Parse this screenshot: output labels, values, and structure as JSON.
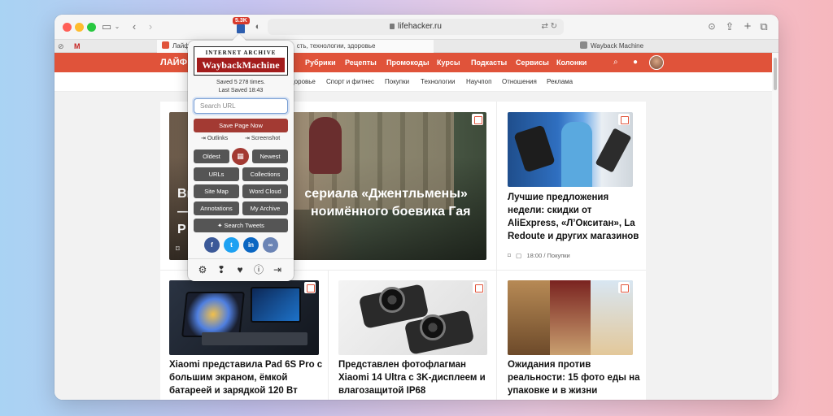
{
  "toolbar": {
    "url": "lifehacker.ru",
    "extension_badge": "5.3K"
  },
  "tabs": [
    {
      "label": "Лайфх",
      "rest": "сть, технологии, здоровье",
      "active": true
    },
    {
      "label": "Wayback Machine",
      "active": false
    }
  ],
  "site": {
    "logo": "ЛАЙФ",
    "nav": [
      "Рубрики",
      "Рецепты",
      "Промокоды",
      "Курсы",
      "Подкасты",
      "Сервисы",
      "Колонки"
    ],
    "subnav": [
      "доровье",
      "Спорт и фитнес",
      "Покупки",
      "Технологии",
      "Научпоп",
      "Отношения",
      "Реклама"
    ]
  },
  "articles": {
    "hero": {
      "title": "Вышел трейлер сериала «Джентльмены» — продолжения одноимённого боевика Гая Ричи",
      "visible_left": "Вь",
      "visible_right": "сериала «Джентльмены»",
      "line2_left": "—",
      "line2_right": "ноимённого боевика Гая",
      "line3_left": "Р"
    },
    "deals": {
      "title": "Лучшие предложения недели: скидки от AliExpress, «Л’Окситан», La Redoute и других магазинов",
      "time": "18:00",
      "category": "Покупки"
    },
    "xiaomi_pad": {
      "title": "Xiaomi представила Pad 6S Pro с большим экраном, ёмкой батареей и зарядкой 120 Вт"
    },
    "xiaomi_14": {
      "title": "Представлен фотофлагман Xiaomi 14 Ultra с 3K-дисплеем и влагозащитой IP68"
    },
    "food": {
      "title": "Ожидания против реальности: 15 фото еды на упаковке и в жизни"
    }
  },
  "wayback": {
    "logo_top": "INTERNET ARCHIVE",
    "logo_main": "WaybackMachine",
    "saved_times": "Saved 5 278 times.",
    "last_saved": "Last Saved 18:43",
    "search_placeholder": "Search URL",
    "save_page": "Save Page Now",
    "outlinks": "Outlinks",
    "screenshot": "Screenshot",
    "oldest": "Oldest",
    "newest": "Newest",
    "urls": "URLs",
    "collections": "Collections",
    "site_map": "Site Map",
    "word_cloud": "Word Cloud",
    "annotations": "Annotations",
    "my_archive": "My Archive",
    "search_tweets": "Search Tweets"
  },
  "colors": {
    "site_accent": "#e0533a",
    "wayback_red": "#a33a33",
    "facebook": "#3b5998",
    "twitter": "#1da1f2",
    "linkedin": "#0a66c2"
  }
}
